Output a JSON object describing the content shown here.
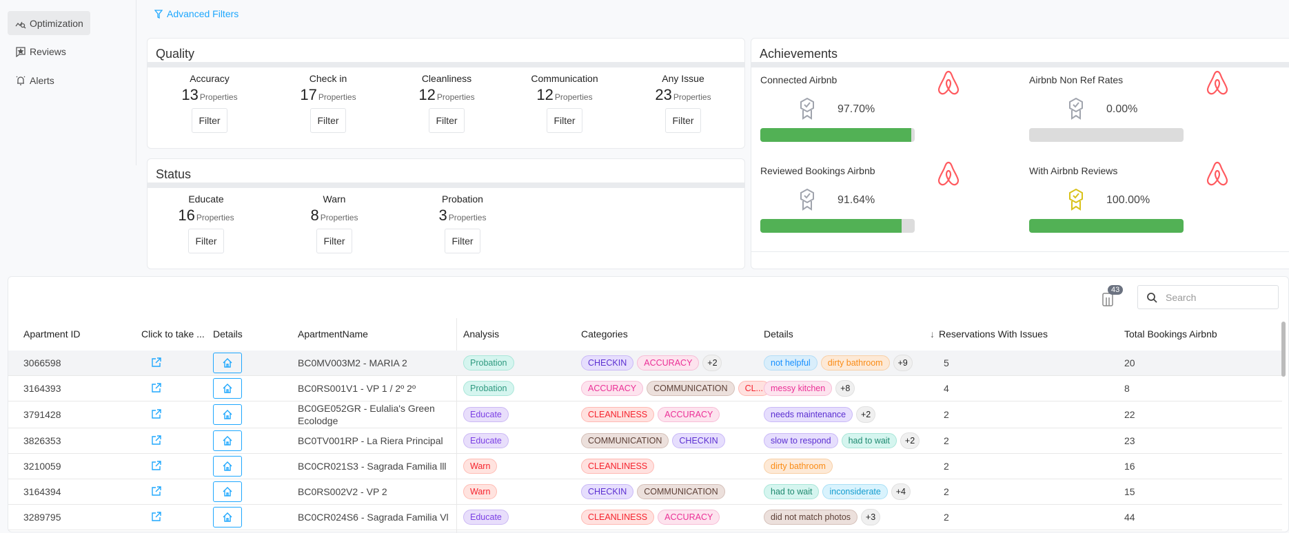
{
  "sidebar": {
    "items": [
      {
        "label": "Optimization",
        "icon": "optimization-icon",
        "active": true
      },
      {
        "label": "Reviews",
        "icon": "reviews-icon"
      },
      {
        "label": "Alerts",
        "icon": "bell-icon"
      }
    ]
  },
  "advanced_filters": "Advanced Filters",
  "quality": {
    "title": "Quality",
    "unit": "Properties",
    "filter_label": "Filter",
    "items": [
      {
        "label": "Accuracy",
        "count": "13"
      },
      {
        "label": "Check in",
        "count": "17"
      },
      {
        "label": "Cleanliness",
        "count": "12"
      },
      {
        "label": "Communication",
        "count": "12"
      },
      {
        "label": "Any Issue",
        "count": "23"
      }
    ]
  },
  "status": {
    "title": "Status",
    "unit": "Properties",
    "filter_label": "Filter",
    "items": [
      {
        "label": "Educate",
        "count": "16"
      },
      {
        "label": "Warn",
        "count": "8"
      },
      {
        "label": "Probation",
        "count": "3"
      }
    ]
  },
  "achievements": {
    "title": "Achievements",
    "items": [
      {
        "label": "Connected Airbnb",
        "value": "97.70%",
        "progress": 97.7,
        "medal_color": "#a0a4ad"
      },
      {
        "label": "Airbnb Non Ref Rates",
        "value": "0.00%",
        "progress": 0,
        "medal_color": "#a0a4ad"
      },
      {
        "label": "Reviewed Bookings Airbnb",
        "value": "91.64%",
        "progress": 91.64,
        "medal_color": "#a0a4ad"
      },
      {
        "label": "With Airbnb Reviews",
        "value": "100.00%",
        "progress": 100,
        "medal_color": "#d9c21a"
      }
    ]
  },
  "colors": {
    "accent": "#1ea7fd",
    "progress": "#52b155",
    "airbnb": "#ff5a5f"
  },
  "toolbar": {
    "columns_badge": "43",
    "search_placeholder": "Search"
  },
  "table": {
    "headers": [
      "Apartment ID",
      "Click to take ...",
      "Details",
      "ApartmentName",
      "Analysis",
      "Categories",
      "Details",
      "Reservations With Issues",
      "Total Bookings Airbnb"
    ],
    "sort": "descending",
    "rows": [
      {
        "id": "3066598",
        "name": "BC0MV003M2 - MARIA 2",
        "analysis": "Probation",
        "categories": [
          "CHECKIN",
          "ACCURACY"
        ],
        "cat_more": "+2",
        "details": [
          "not helpful",
          "dirty bathroom"
        ],
        "det_more": "+9",
        "reservations": "5",
        "total": "20"
      },
      {
        "id": "3164393",
        "name": "BC0RS001V1 - VP 1 / 2º 2º",
        "analysis": "Probation",
        "categories": [
          "ACCURACY",
          "COMMUNICATION",
          "CL..."
        ],
        "cat_more": "",
        "details": [
          "messy kitchen"
        ],
        "det_more": "+8",
        "reservations": "4",
        "total": "8"
      },
      {
        "id": "3791428",
        "name": "BC0GE052GR - Eulalia's Green Ecolodge",
        "analysis": "Educate",
        "categories": [
          "CLEANLINESS",
          "ACCURACY"
        ],
        "cat_more": "",
        "details": [
          "needs maintenance"
        ],
        "det_more": "+2",
        "reservations": "2",
        "total": "22"
      },
      {
        "id": "3826353",
        "name": "BC0TV001RP - La Riera Principal",
        "analysis": "Educate",
        "categories": [
          "COMMUNICATION",
          "CHECKIN"
        ],
        "cat_more": "",
        "details": [
          "slow to respond",
          "had to wait"
        ],
        "det_more": "+2",
        "reservations": "2",
        "total": "23"
      },
      {
        "id": "3210059",
        "name": "BC0CR021S3 - Sagrada Familia lll",
        "analysis": "Warn",
        "categories": [
          "CLEANLINESS"
        ],
        "cat_more": "",
        "details": [
          "dirty bathroom"
        ],
        "det_more": "",
        "reservations": "2",
        "total": "16"
      },
      {
        "id": "3164394",
        "name": "BC0RS002V2 - VP 2",
        "analysis": "Warn",
        "categories": [
          "CHECKIN",
          "COMMUNICATION"
        ],
        "cat_more": "",
        "details": [
          "had to wait",
          "inconsiderate"
        ],
        "det_more": "+4",
        "reservations": "2",
        "total": "15"
      },
      {
        "id": "3289795",
        "name": "BC0CR024S6 - Sagrada Familia Vl",
        "analysis": "Educate",
        "categories": [
          "CLEANLINESS",
          "ACCURACY"
        ],
        "cat_more": "",
        "details": [
          "did not match photos"
        ],
        "det_more": "+3",
        "reservations": "2",
        "total": "44"
      }
    ]
  }
}
